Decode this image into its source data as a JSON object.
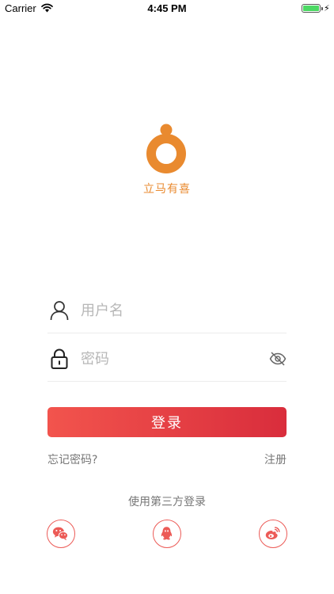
{
  "status_bar": {
    "carrier": "Carrier",
    "time": "4:45 PM",
    "battery_icon": "battery-full-icon",
    "charging_icon": "⚡"
  },
  "app": {
    "name": "立马有喜",
    "brand_color": "#e98a2f"
  },
  "login_form": {
    "username": {
      "placeholder": "用户名",
      "value": "",
      "icon": "user-icon"
    },
    "password": {
      "placeholder": "密码",
      "value": "",
      "icon": "lock-icon",
      "toggle_icon": "eye-off-icon"
    },
    "login_label": "登录",
    "login_gradient": [
      "#f2544d",
      "#d92d3c"
    ],
    "forgot_label": "忘记密码?",
    "register_label": "注册"
  },
  "third_party": {
    "title": "使用第三方登录",
    "accent_color": "#ec5b57",
    "providers": [
      {
        "icon": "wechat-icon"
      },
      {
        "icon": "qq-icon"
      },
      {
        "icon": "weibo-icon"
      }
    ]
  }
}
